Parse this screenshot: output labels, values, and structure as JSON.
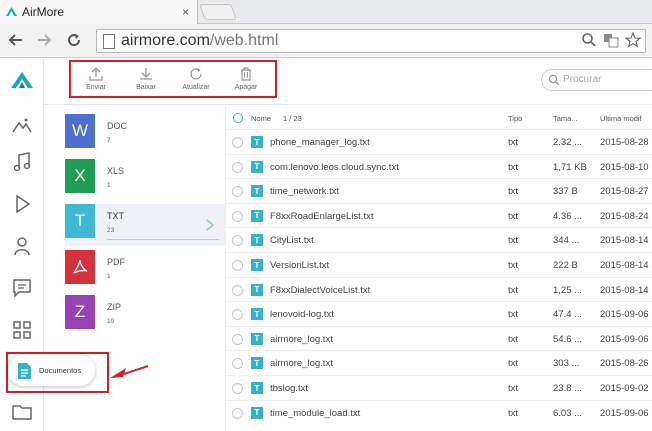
{
  "browser": {
    "tab_title": "AirMore",
    "close_glyph": "×",
    "url_host": "airmore.com",
    "url_path": "/web.html"
  },
  "sidebar": {
    "items": [
      {
        "icon": "mountain-icon"
      },
      {
        "icon": "music-icon"
      },
      {
        "icon": "play-icon"
      },
      {
        "icon": "contact-icon"
      },
      {
        "icon": "message-icon"
      },
      {
        "icon": "apps-icon"
      },
      {
        "icon": "folder-icon"
      }
    ],
    "documents_label": "Documentos"
  },
  "actions": {
    "send": "Enviar",
    "download": "Baixar",
    "refresh": "Atualizar",
    "delete": "Apagar"
  },
  "search": {
    "placeholder": "Procurar"
  },
  "categories": [
    {
      "letter": "W",
      "name": "DOC",
      "count": "7",
      "color": "#4d6fd0"
    },
    {
      "letter": "X",
      "name": "XLS",
      "count": "1",
      "color": "#1e9d55"
    },
    {
      "letter": "T",
      "name": "TXT",
      "count": "23",
      "color": "#3fb8d6"
    },
    {
      "letter": "",
      "name": "PDF",
      "count": "1",
      "color": "#d6303a"
    },
    {
      "letter": "Z",
      "name": "ZIP",
      "count": "10",
      "color": "#9a42b5"
    }
  ],
  "table": {
    "headers": {
      "name": "Nome",
      "count": "1 / 23",
      "type": "Tipo",
      "size": "Tama...",
      "date": "Última modif"
    },
    "rows": [
      {
        "name": "phone_manager_log.txt",
        "type": "txt",
        "size": "2.32 ...",
        "date": "2015-08-28"
      },
      {
        "name": "com.lenovo.leos.cloud.sync.txt",
        "type": "txt",
        "size": "1,71 KB",
        "date": "2015-08-10"
      },
      {
        "name": "time_network.txt",
        "type": "txt",
        "size": "337 B",
        "date": "2015-08-27"
      },
      {
        "name": "F8xxRoadEnlargeList.txt",
        "type": "txt",
        "size": "4.36 ...",
        "date": "2015-08-24"
      },
      {
        "name": "CityList.txt",
        "type": "txt",
        "size": "344 ...",
        "date": "2015-08-14"
      },
      {
        "name": "VersionList.txt",
        "type": "txt",
        "size": "222 B",
        "date": "2015-08-14"
      },
      {
        "name": "F8xxDialectVoiceList.txt",
        "type": "txt",
        "size": "1,25 ...",
        "date": "2015-08-14"
      },
      {
        "name": "lenovoid-log.txt",
        "type": "txt",
        "size": "47.4 ...",
        "date": "2015-09-06"
      },
      {
        "name": "airmore_log.txt",
        "type": "txt",
        "size": "54.6 ...",
        "date": "2015-09-06"
      },
      {
        "name": "airmore_log.txt",
        "type": "txt",
        "size": "303 ...",
        "date": "2015-08-26"
      },
      {
        "name": "tbslog.txt",
        "type": "txt",
        "size": "23.8 ...",
        "date": "2015-09-02"
      },
      {
        "name": "time_module_load.txt",
        "type": "txt",
        "size": "6.03 ...",
        "date": "2015-09-06"
      }
    ]
  },
  "colors": {
    "accent": "#3bb7c9",
    "highlight": "#d0202a"
  }
}
